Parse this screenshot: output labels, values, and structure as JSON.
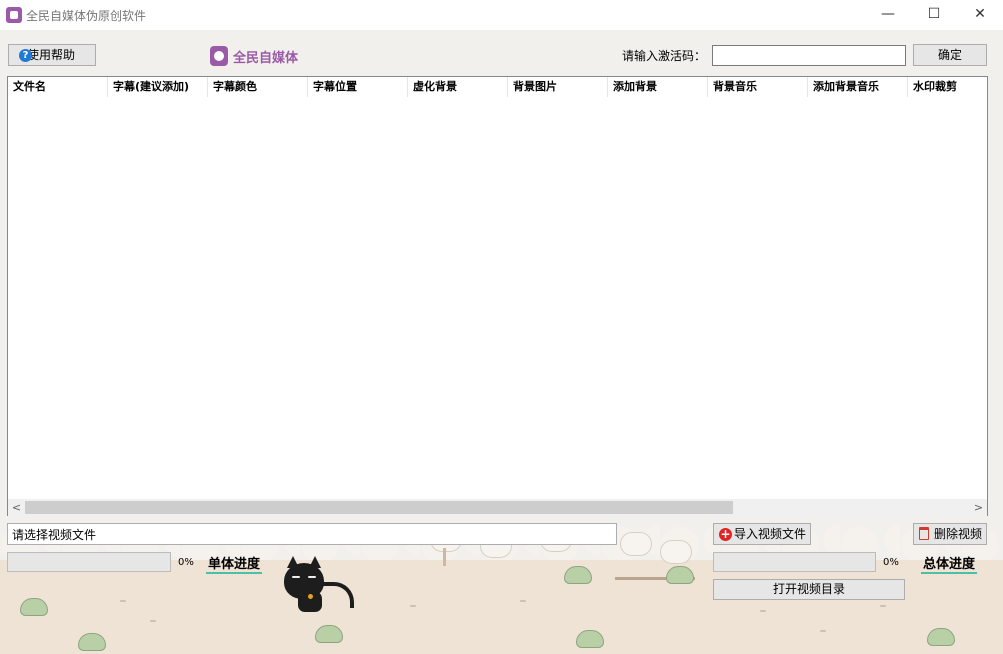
{
  "window": {
    "title": "全民自媒体伪原创软件",
    "controls": {
      "minimize": "—",
      "maximize": "☐",
      "close": "✕"
    }
  },
  "toolbar": {
    "help_label": "使用帮助",
    "brand": "全民自媒体",
    "activation_label": "请输入激活码：",
    "activation_value": "",
    "ok_label": "确定"
  },
  "table": {
    "columns": [
      "文件名",
      "字幕(建议添加)",
      "字幕颜色",
      "字幕位置",
      "虚化背景",
      "背景图片",
      "添加背景",
      "背景音乐",
      "添加背景音乐",
      "水印裁剪"
    ],
    "rows": [],
    "scroll": {
      "left": "<",
      "right": ">"
    }
  },
  "bottom": {
    "path_value": "请选择视频文件",
    "import_label": "导入视频文件",
    "delete_label": "删除视频",
    "single_progress": {
      "percent_text": "0%",
      "label": "单体进度",
      "fraction": 0
    },
    "total_progress": {
      "percent_text": "0%",
      "label": "总体进度",
      "fraction": 0
    },
    "open_dir_label": "打开视频目录"
  },
  "icons": {
    "app": "app-logo-icon",
    "help": "question-icon",
    "brand": "brand-logo-icon",
    "import": "plus-circle-icon",
    "delete": "trash-icon"
  },
  "colors": {
    "brand": "#9a5aa8",
    "progress_fill": "#06b025",
    "import_icon": "#e02424",
    "help_icon": "#1f7ad6"
  }
}
